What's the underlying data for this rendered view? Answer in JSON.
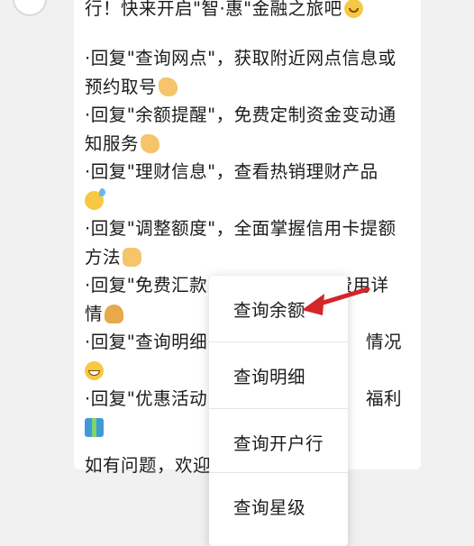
{
  "message": {
    "lines": [
      {
        "text": "行！快来开启\"智·惠\"金融之旅吧",
        "emoji": "smile-icon"
      },
      {
        "text": "·回复\"查询网点\"，获取附近网点信息或",
        "emoji": ""
      },
      {
        "text": "预约取号",
        "emoji": "ok-hand-icon"
      },
      {
        "text": "·回复\"余额提醒\"，免费定制资金变动通",
        "emoji": ""
      },
      {
        "text": "知服务",
        "emoji": "victory-hand-icon"
      },
      {
        "text": "·回复\"理财信息\"，查看热销理财产品",
        "emoji": ""
      },
      {
        "text": "",
        "emoji": "sweat-smile-icon"
      },
      {
        "text": "·回复\"调整额度\"，全面掌握信用卡提额",
        "emoji": ""
      },
      {
        "text": "方法",
        "emoji": "thumbs-up-icon"
      },
      {
        "text": "·回复\"免费汇款\"，了解汇款\"0\"费用详",
        "emoji": ""
      },
      {
        "text": "情",
        "emoji": "snail-icon"
      },
      {
        "text": "·回复\"查询明细",
        "tail": "情况",
        "emoji": ""
      },
      {
        "text": "",
        "emoji": "grin-icon"
      },
      {
        "text": "·回复\"优惠活动",
        "tail": "福利",
        "emoji": ""
      },
      {
        "text": "",
        "emoji": "gift-icon"
      },
      {
        "text": "如有问题，欢迎",
        "emoji": ""
      }
    ]
  },
  "context_menu": {
    "items": [
      {
        "label": "查询余额"
      },
      {
        "label": "查询明细"
      },
      {
        "label": "查询开户行"
      },
      {
        "label": "查询星级"
      }
    ]
  },
  "colors": {
    "background": "#f1f1f1",
    "bubble": "#ffffff",
    "arrow": "#d3262b"
  }
}
